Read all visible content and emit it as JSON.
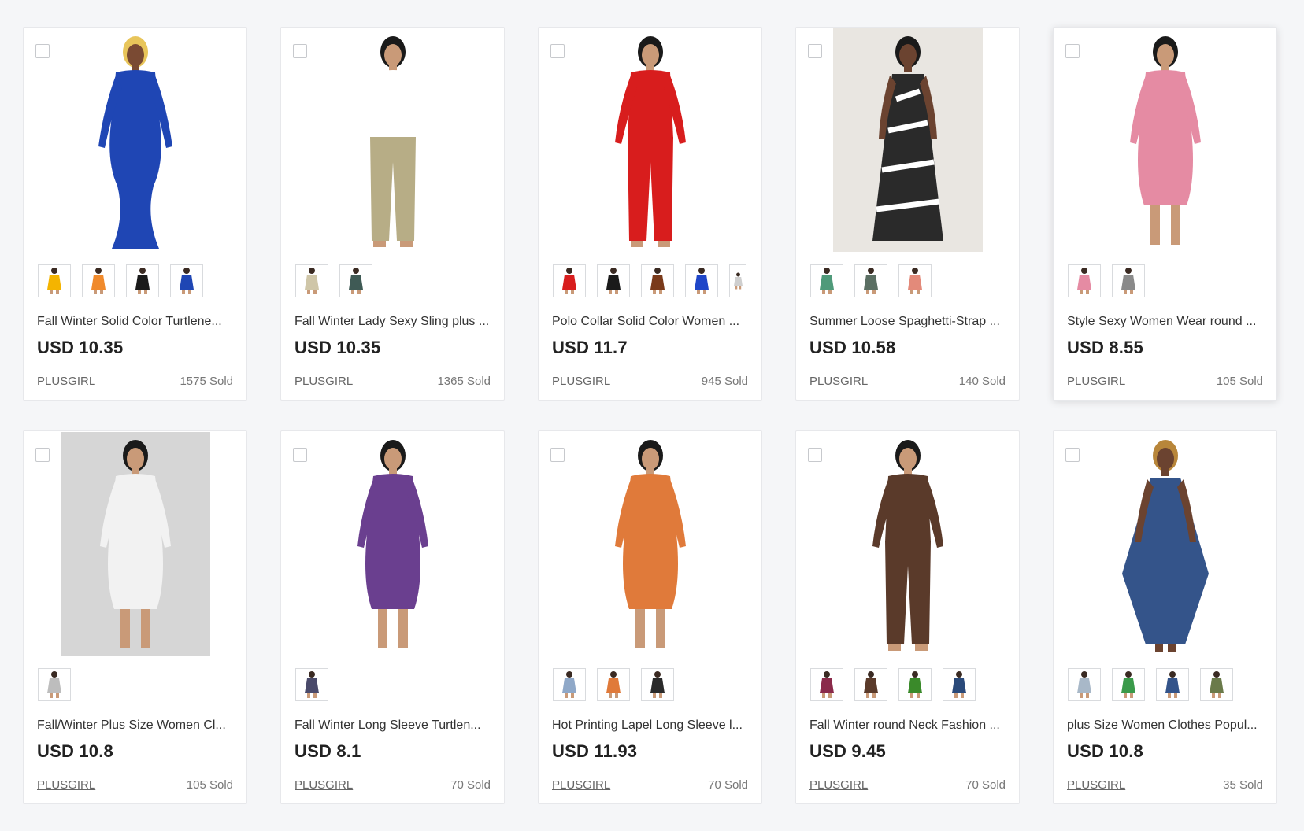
{
  "products": [
    {
      "title": "Fall Winter Solid Color Turtlene...",
      "price": "USD 10.35",
      "store": "PLUSGIRL",
      "sold": "1575 Sold",
      "image": {
        "kind": "model",
        "garment": "#1f46b4",
        "hair": "#e8c55a",
        "skin": "#7a4a33",
        "style": "gown"
      },
      "swatches": [
        "#f4b400",
        "#f08a2c",
        "#1a1a1a",
        "#1f46b4"
      ]
    },
    {
      "title": "Fall Winter Lady Sexy Sling plus ...",
      "price": "USD 10.35",
      "store": "PLUSGIRL",
      "sold": "1365 Sold",
      "image": {
        "kind": "model",
        "garment": "#b7ad86",
        "top": "#ffffff",
        "hair": "#1a1a1a",
        "skin": "#c99a78",
        "style": "pants"
      },
      "swatches": [
        "#cfc6a8",
        "#3f5a55"
      ]
    },
    {
      "title": "Polo Collar Solid Color Women ...",
      "price": "USD 11.7",
      "store": "PLUSGIRL",
      "sold": "945 Sold",
      "image": {
        "kind": "model",
        "garment": "#d81d1d",
        "hair": "#1a1a1a",
        "skin": "#c99a78",
        "style": "pants"
      },
      "swatches": [
        "#d81d1d",
        "#1a1a1a",
        "#7a3a1a",
        "#1f46c8",
        "#cfcfcf"
      ]
    },
    {
      "title": "Summer Loose Spaghetti-Strap ...",
      "price": "USD 10.58",
      "store": "PLUSGIRL",
      "sold": "140 Sold",
      "image": {
        "kind": "photo",
        "garment": "#2a2a2a",
        "hair": "#1a1a1a",
        "skin": "#6b4330",
        "style": "maxi"
      },
      "swatches": [
        "#4f9a7a",
        "#5b6f63",
        "#e38a7a"
      ]
    },
    {
      "title": "Style Sexy Women Wear round ...",
      "price": "USD 8.55",
      "store": "PLUSGIRL",
      "sold": "105 Sold",
      "image": {
        "kind": "model",
        "garment": "#e58ba3",
        "hair": "#1a1a1a",
        "skin": "#c99a78",
        "style": "dress"
      },
      "swatches": [
        "#e58ba3",
        "#8a8a8a"
      ]
    },
    {
      "title": "Fall/Winter Plus Size Women Cl...",
      "price": "USD 10.8",
      "store": "PLUSGIRL",
      "sold": "105 Sold",
      "image": {
        "kind": "photo-grey",
        "garment": "#f2f2f2",
        "hair": "#1a1a1a",
        "skin": "#c99a78",
        "style": "dress"
      },
      "swatches": [
        "#bdbdbd"
      ]
    },
    {
      "title": "Fall Winter Long Sleeve Turtlen...",
      "price": "USD 8.1",
      "store": "PLUSGIRL",
      "sold": "70 Sold",
      "image": {
        "kind": "model",
        "garment": "#6a3f8f",
        "hair": "#1a1a1a",
        "skin": "#c99a78",
        "style": "dress"
      },
      "swatches": [
        "#4a4a6a"
      ]
    },
    {
      "title": "Hot Printing Lapel Long Sleeve l...",
      "price": "USD 11.93",
      "store": "PLUSGIRL",
      "sold": "70 Sold",
      "image": {
        "kind": "model",
        "garment": "#e07a3a",
        "hair": "#1a1a1a",
        "skin": "#c99a78",
        "style": "dress"
      },
      "swatches": [
        "#8fa8c8",
        "#e07a3a",
        "#2a2a2a"
      ]
    },
    {
      "title": "Fall Winter round Neck Fashion ...",
      "price": "USD 9.45",
      "store": "PLUSGIRL",
      "sold": "70 Sold",
      "image": {
        "kind": "model",
        "garment": "#5a3a2a",
        "hair": "#1a1a1a",
        "skin": "#c99a78",
        "style": "pants"
      },
      "swatches": [
        "#8a2a4a",
        "#5a3a2a",
        "#3a8a2a",
        "#2a4a7a"
      ]
    },
    {
      "title": "plus Size Women Clothes Popul...",
      "price": "USD 10.8",
      "store": "PLUSGIRL",
      "sold": "35 Sold",
      "image": {
        "kind": "model",
        "garment": "#34548a",
        "hair": "#b8863a",
        "skin": "#6b4330",
        "style": "harem"
      },
      "swatches": [
        "#a8b8c8",
        "#3a9a4a",
        "#34548a",
        "#6a7a4a"
      ]
    }
  ]
}
